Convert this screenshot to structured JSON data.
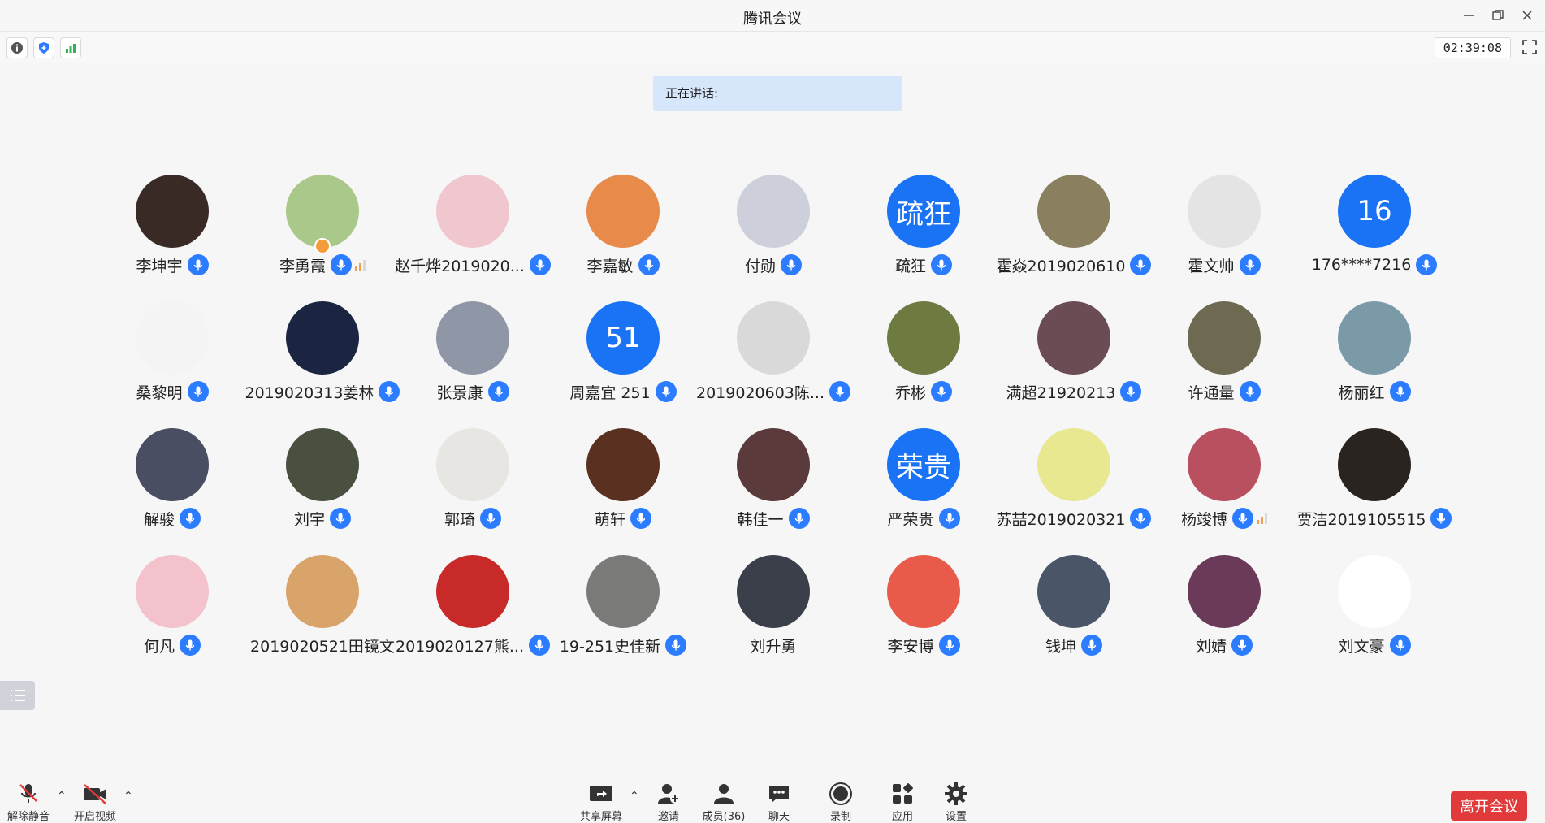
{
  "window": {
    "title": "腾讯会议",
    "controls": [
      "minimize-icon",
      "restore-icon",
      "close-icon"
    ]
  },
  "toolbar": {
    "icons": [
      "info-icon",
      "shield-icon",
      "signal-icon"
    ],
    "timer": "02:39:08"
  },
  "speaking_label": "正在讲话:",
  "accent_color": "#2b7cff",
  "participants": [
    {
      "name": "李坤宇",
      "mic": true
    },
    {
      "name": "李勇霞",
      "mic": true,
      "host": true,
      "volume": true
    },
    {
      "name": "赵千烨2019020...",
      "mic": true
    },
    {
      "name": "李嘉敏",
      "mic": true
    },
    {
      "name": "付勋",
      "mic": true
    },
    {
      "name": "疏狂",
      "mic": true,
      "avatar_text": "疏狂",
      "avatar_color": "#1a73f5"
    },
    {
      "name": "霍焱2019020610",
      "mic": true
    },
    {
      "name": "霍文帅",
      "mic": true
    },
    {
      "name": "176****7216",
      "mic": true,
      "avatar_text": "16",
      "avatar_color": "#1a73f5"
    },
    {
      "name": "桑黎明",
      "mic": true
    },
    {
      "name": "2019020313姜林",
      "mic": true
    },
    {
      "name": "张景康",
      "mic": true
    },
    {
      "name": "周嘉宜 251",
      "mic": true,
      "avatar_text": "51",
      "avatar_color": "#1a73f5"
    },
    {
      "name": "2019020603陈...",
      "mic": true
    },
    {
      "name": "乔彬",
      "mic": true
    },
    {
      "name": "满超21920213",
      "mic": true
    },
    {
      "name": "许通量",
      "mic": true
    },
    {
      "name": "杨丽红",
      "mic": true
    },
    {
      "name": "解骏",
      "mic": true
    },
    {
      "name": "刘宇",
      "mic": true
    },
    {
      "name": "郭琦",
      "mic": true
    },
    {
      "name": "萌轩",
      "mic": true
    },
    {
      "name": "韩佳一",
      "mic": true
    },
    {
      "name": "严荣贵",
      "mic": true,
      "avatar_text": "荣贵",
      "avatar_color": "#1a73f5"
    },
    {
      "name": "苏喆2019020321",
      "mic": true
    },
    {
      "name": "杨竣博",
      "mic": true,
      "volume": true
    },
    {
      "name": "贾洁2019105515",
      "mic": true
    },
    {
      "name": "何凡",
      "mic": true
    },
    {
      "name": "2019020521田镜文",
      "mic": false
    },
    {
      "name": "2019020127熊...",
      "mic": true
    },
    {
      "name": "19-251史佳新",
      "mic": true
    },
    {
      "name": "刘升勇",
      "mic": false
    },
    {
      "name": "李安博",
      "mic": true
    },
    {
      "name": "钱坤",
      "mic": true
    },
    {
      "name": "刘婧",
      "mic": true
    },
    {
      "name": "刘文豪",
      "mic": true
    }
  ],
  "bottom": {
    "mute": "解除静音",
    "video": "开启视频",
    "share": "共享屏幕",
    "invite": "邀请",
    "members": "成员(36)",
    "chat": "聊天",
    "record": "录制",
    "apps": "应用",
    "settings": "设置",
    "leave": "离开会议"
  }
}
